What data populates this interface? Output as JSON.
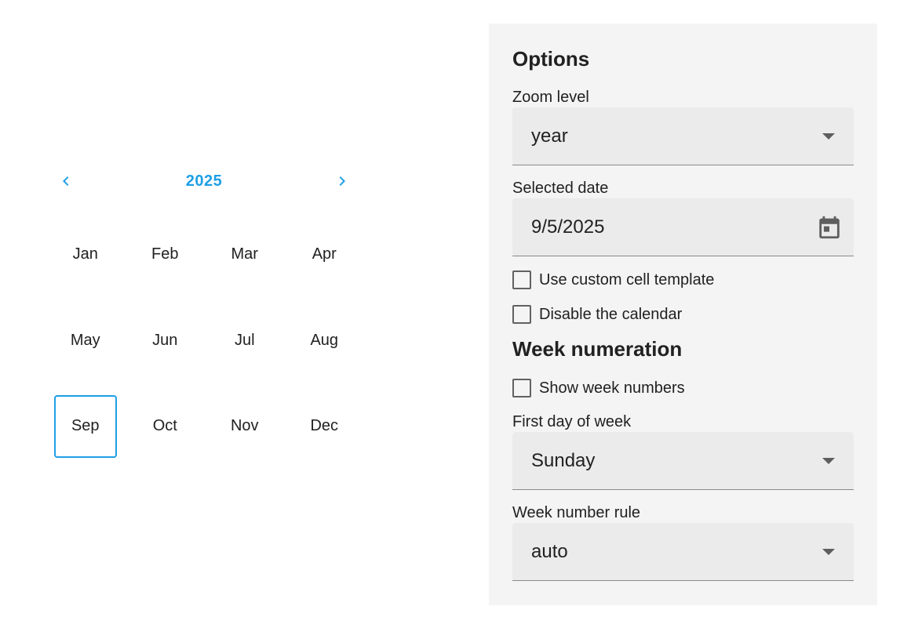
{
  "calendar": {
    "year_title": "2025",
    "prev_icon": "chevron-left-icon",
    "next_icon": "chevron-right-icon",
    "months": [
      "Jan",
      "Feb",
      "Mar",
      "Apr",
      "May",
      "Jun",
      "Jul",
      "Aug",
      "Sep",
      "Oct",
      "Nov",
      "Dec"
    ],
    "selected_month": "Sep",
    "accent_color": "#1e9fe6"
  },
  "options": {
    "heading": "Options",
    "zoom_level": {
      "label": "Zoom level",
      "value": "year"
    },
    "selected_date": {
      "label": "Selected date",
      "value": "9/5/2025",
      "icon": "calendar-icon"
    },
    "custom_cell_template": {
      "label": "Use custom cell template",
      "checked": false
    },
    "disable_calendar": {
      "label": "Disable the calendar",
      "checked": false
    }
  },
  "week_numeration": {
    "heading": "Week numeration",
    "show_week_numbers": {
      "label": "Show week numbers",
      "checked": false
    },
    "first_day_of_week": {
      "label": "First day of week",
      "value": "Sunday"
    },
    "week_number_rule": {
      "label": "Week number rule",
      "value": "auto"
    }
  }
}
